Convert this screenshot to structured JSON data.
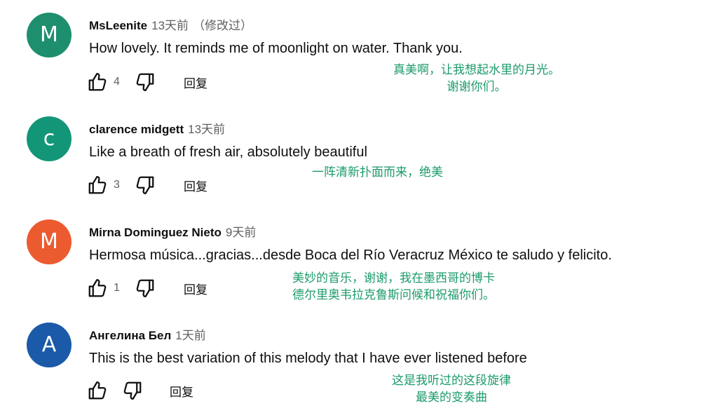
{
  "colors": {
    "avatar_m1": "#1e8f6e",
    "avatar_c": "#139678",
    "avatar_m2": "#ec5a30",
    "avatar_a": "#1a5aa8",
    "translation": "#1c9b6a"
  },
  "comments": [
    {
      "avatar_letter": "M",
      "author": "MsLeenite",
      "time": "13天前",
      "edited": "（修改过）",
      "text": "How lovely. It reminds me of moonlight on water. Thank you.",
      "likes": "4",
      "reply_label": "回复",
      "translation": [
        "真美啊，让我想起水里的月光。",
        "谢谢你们。"
      ]
    },
    {
      "avatar_letter": "c",
      "author": "clarence midgett",
      "time": "13天前",
      "text": "Like a breath of fresh air, absolutely beautiful",
      "likes": "3",
      "reply_label": "回复",
      "translation": [
        "一阵清新扑面而来，绝美"
      ]
    },
    {
      "avatar_letter": "M",
      "author": "Mirna Dominguez Nieto",
      "time": "9天前",
      "text": "Hermosa música...gracias...desde Boca del Río Veracruz México te saludo y felicito.",
      "likes": "1",
      "reply_label": "回复",
      "translation": [
        "美妙的音乐，谢谢，我在墨西哥的博卡",
        "德尔里奥韦拉克鲁斯问候和祝福你们。"
      ]
    },
    {
      "avatar_letter": "A",
      "author": "Ангелина Бел",
      "time": "1天前",
      "text": "This is the best variation of this melody that I have ever listened before",
      "likes": "",
      "reply_label": "回复",
      "translation": [
        "这是我听过的这段旋律",
        "最美的变奏曲"
      ]
    }
  ]
}
